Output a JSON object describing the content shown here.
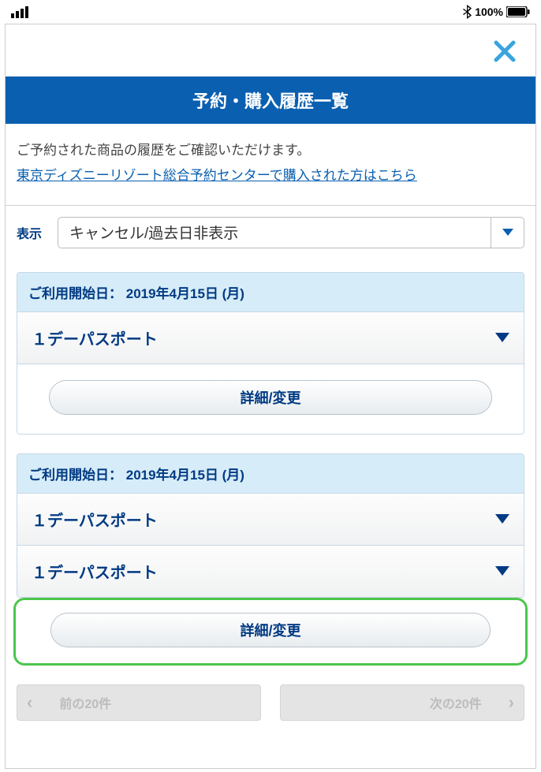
{
  "status": {
    "bluetooth": "✱",
    "battery_pct": "100%"
  },
  "header": {
    "title": "予約・購入履歴一覧"
  },
  "intro": {
    "text": "ご予約された商品の履歴をご確認いただけます。",
    "link": "東京ディズニーリゾート総合予約センターで購入された方はこちら"
  },
  "filter": {
    "label": "表示",
    "selected": "キャンセル/過去日非表示"
  },
  "cards": [
    {
      "date_label": "ご利用開始日：",
      "date_value": "2019年4月15日 (月)",
      "items": [
        {
          "name": "１デーパスポート"
        }
      ],
      "detail_label": "詳細/変更"
    },
    {
      "date_label": "ご利用開始日：",
      "date_value": "2019年4月15日 (月)",
      "items": [
        {
          "name": "１デーパスポート"
        },
        {
          "name": "１デーパスポート"
        }
      ],
      "detail_label": "詳細/変更"
    }
  ],
  "pager": {
    "prev": "前の20件",
    "next": "次の20件"
  }
}
